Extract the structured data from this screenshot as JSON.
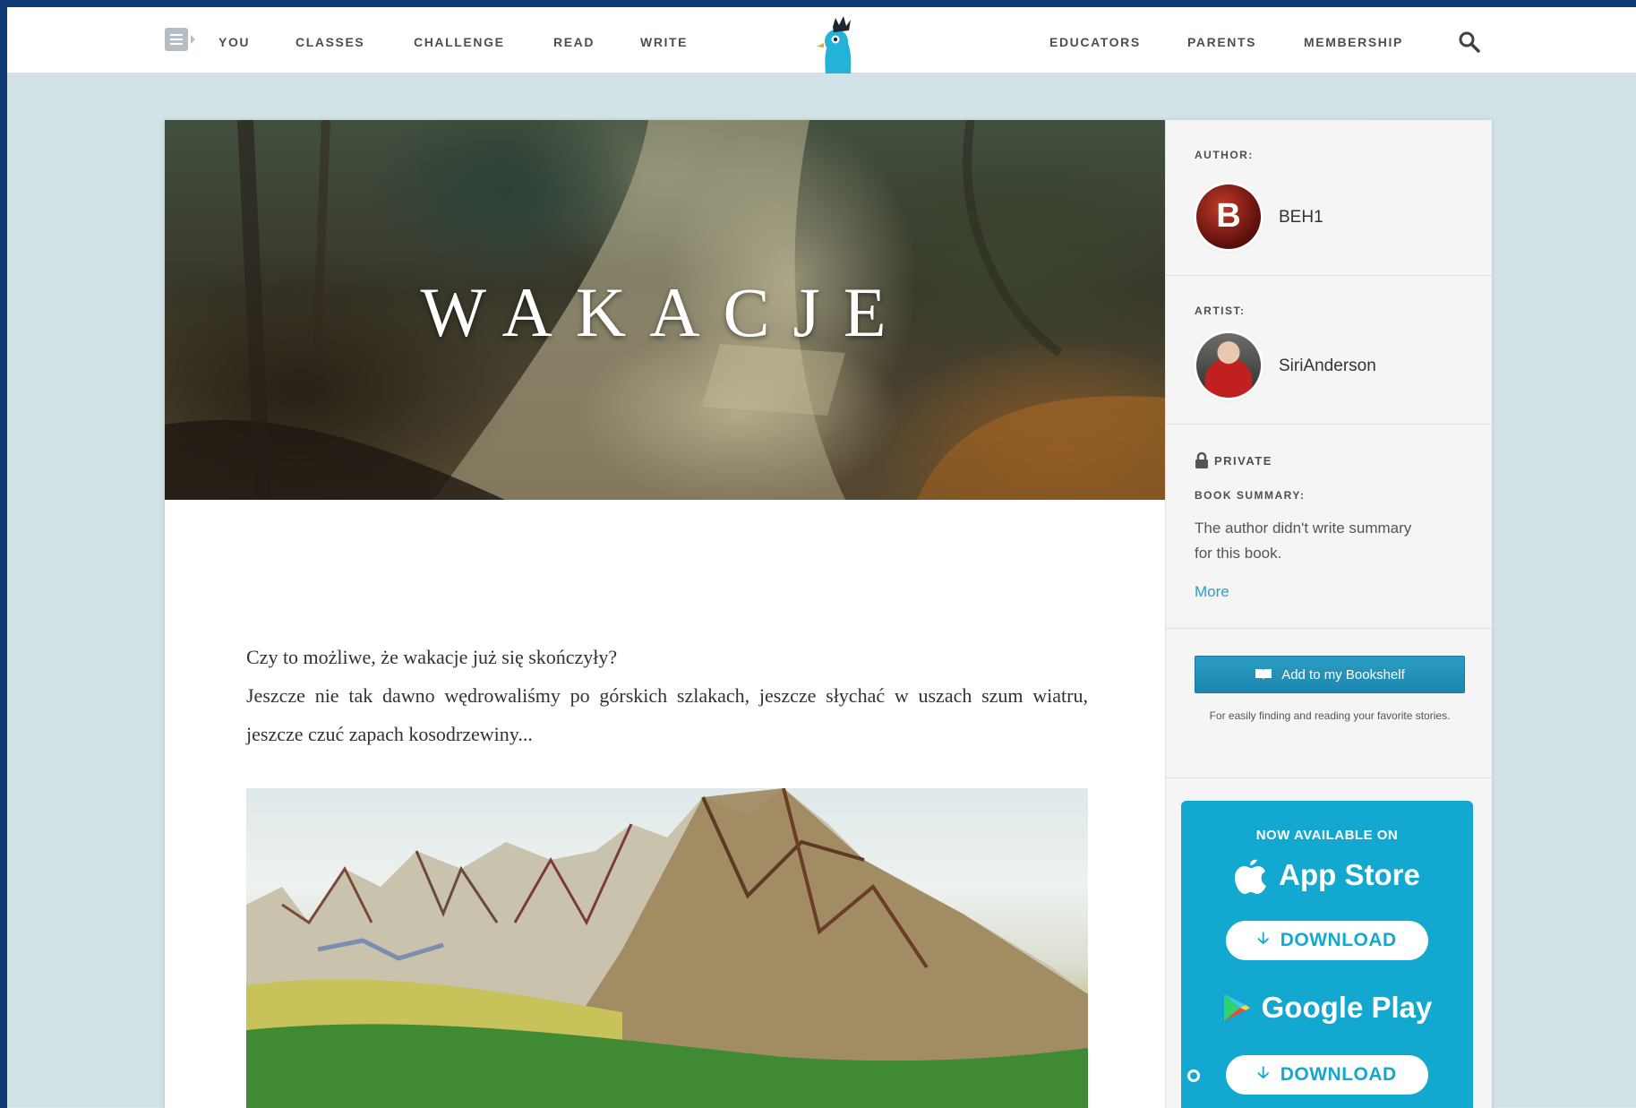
{
  "nav": {
    "left_items": [
      "YOU",
      "CLASSES",
      "CHALLENGE",
      "READ",
      "WRITE"
    ],
    "right_items": [
      "EDUCATORS",
      "PARENTS",
      "MEMBERSHIP"
    ],
    "logo_icon": "bird-with-crown-logo",
    "search_icon": "search-icon"
  },
  "book": {
    "title": "WAKACJE",
    "paragraphs": [
      "Czy to możliwe, że wakacje już się skończyły?",
      "Jeszcze nie tak dawno wędrowaliśmy po górskich szlakach, jeszcze słychać w uszach szum wiatru, jeszcze czuć zapach kosodrzewiny..."
    ]
  },
  "sidebar": {
    "author_label": "AUTHOR:",
    "author_initial": "B",
    "author_name": "BEH1",
    "artist_label": "ARTIST:",
    "artist_name": "SiriAnderson",
    "privacy_label": "PRIVATE",
    "summary_label": "BOOK SUMMARY:",
    "summary_text": "The author didn't write summary for this book.",
    "more_link": "More",
    "bookshelf_button": "Add to my Bookshelf",
    "bookshelf_note": "For easily finding and reading your favorite stories."
  },
  "app_promo": {
    "heading": "NOW AVAILABLE ON",
    "stores": [
      {
        "name": "App Store",
        "download": "DOWNLOAD"
      },
      {
        "name": "Google Play",
        "download": "DOWNLOAD"
      }
    ]
  },
  "colors": {
    "accent": "#12a8cf",
    "button": "#2b9ec5",
    "link": "#27a0c8",
    "frame_border": "#0d3a73"
  }
}
